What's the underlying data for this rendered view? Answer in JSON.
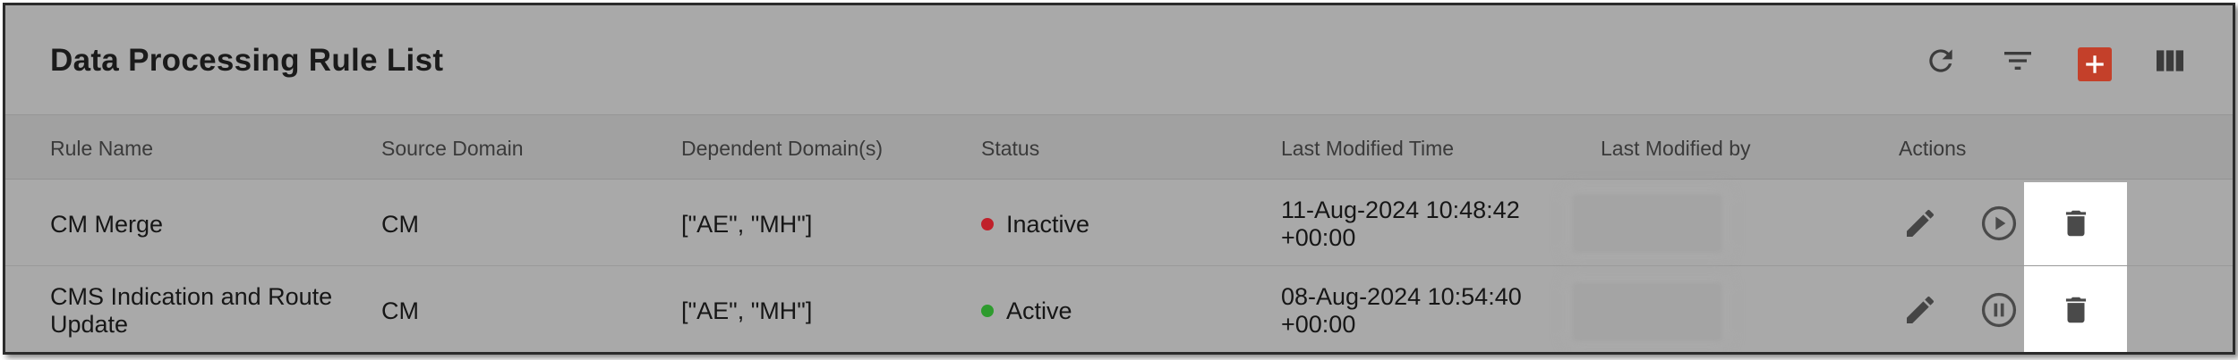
{
  "header": {
    "title": "Data Processing Rule List"
  },
  "toolbar": {
    "refresh_icon": "refresh-icon",
    "filter_icon": "filter-icon",
    "add_icon": "plus-icon",
    "columns_icon": "columns-icon",
    "add_color": "#c4402a"
  },
  "table": {
    "columns": [
      "Rule Name",
      "Source Domain",
      "Dependent Domain(s)",
      "Status",
      "Last Modified Time",
      "Last Modified by",
      "Actions"
    ],
    "rows": [
      {
        "rule_name": "CM Merge",
        "source_domain": "CM",
        "dependent_domains": "[\"AE\", \"MH\"]",
        "status": "Inactive",
        "status_color": "#c0202a",
        "modified_time_line1": "11-Aug-2024 10:48:42",
        "modified_time_line2": "+00:00",
        "toggle_icon": "play-circle-icon"
      },
      {
        "rule_name_line1": "CMS Indication and Route",
        "rule_name_line2": "Update",
        "source_domain": "CM",
        "dependent_domains": "[\"AE\", \"MH\"]",
        "status": "Active",
        "status_color": "#2e9b2e",
        "modified_time_line1": "08-Aug-2024 10:54:40",
        "modified_time_line2": "+00:00",
        "toggle_icon": "pause-circle-icon"
      }
    ]
  }
}
